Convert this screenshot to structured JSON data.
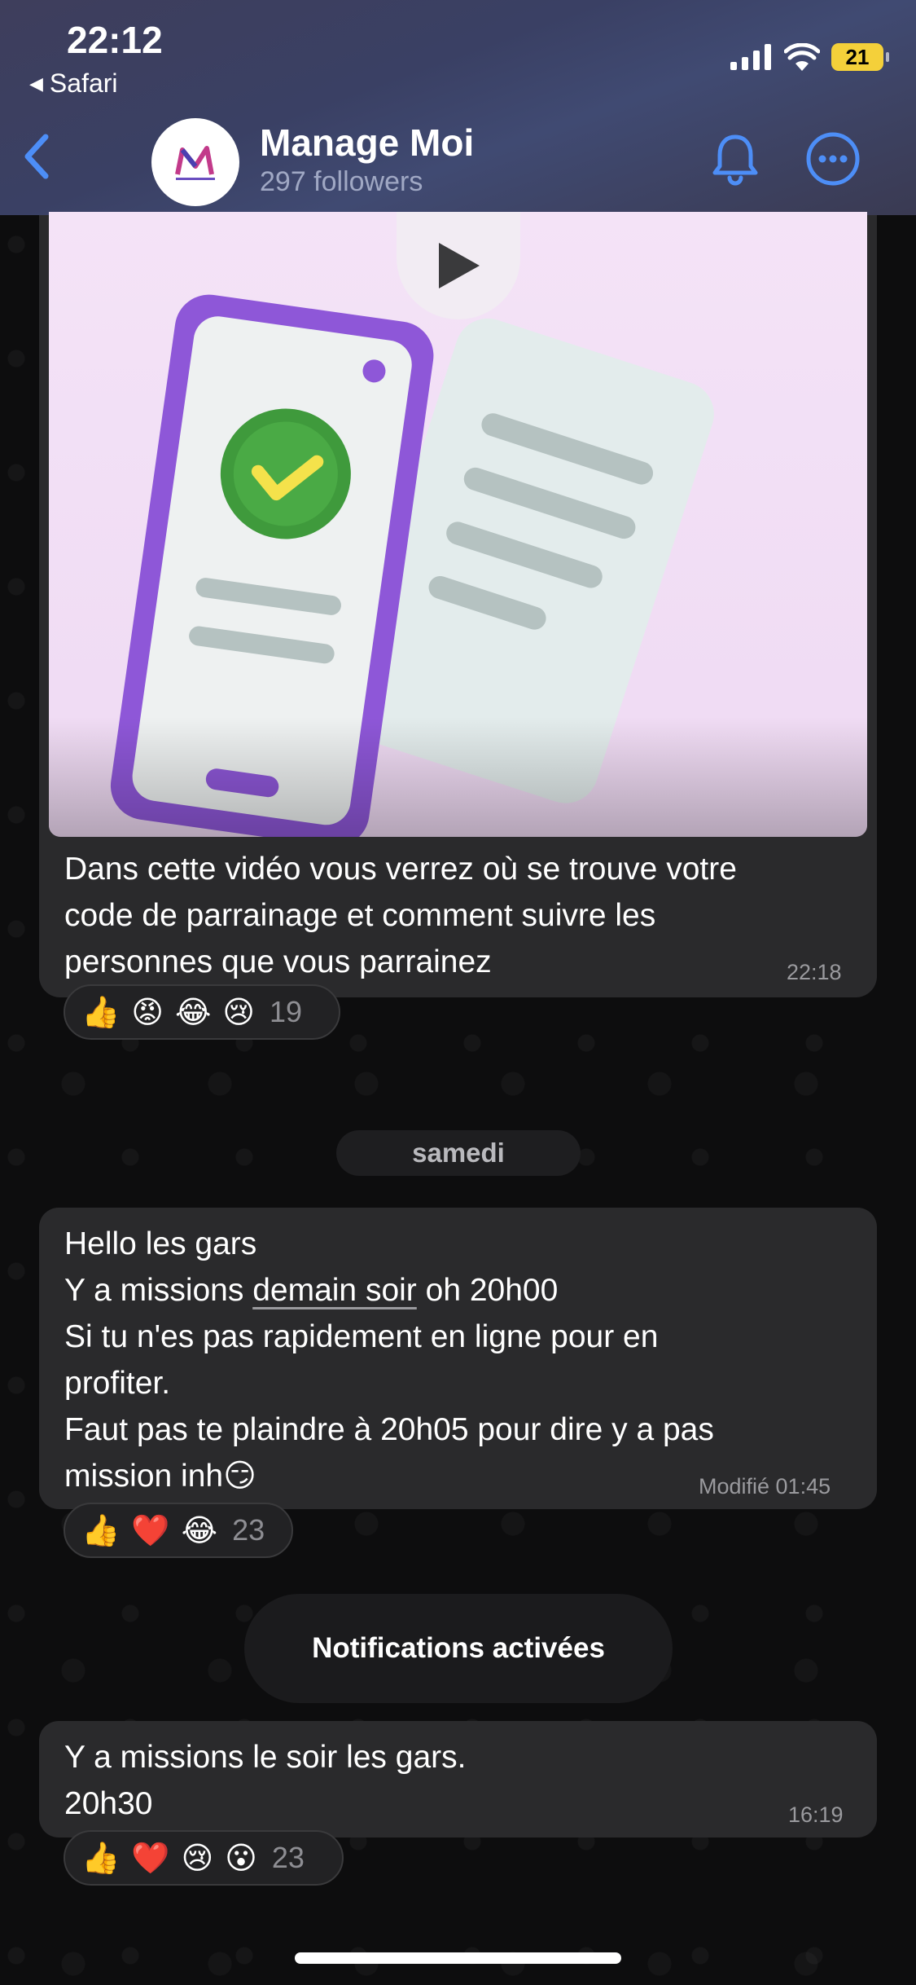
{
  "status_bar": {
    "time": "22:12",
    "back_app": "Safari",
    "battery": "21",
    "battery_color": "#f4d03a"
  },
  "header": {
    "channel_name": "Manage Moi",
    "followers": "297 followers",
    "back_icon": "chevron-left-icon",
    "bell_icon": "bell-icon",
    "more_icon": "more-icon",
    "accent_color": "#4d8ef7"
  },
  "messages": [
    {
      "type": "video",
      "caption": "Dans cette vidéo vous verrez où se trouve votre\ncode de parrainage et comment suivre les\npersonnes que vous parrainez",
      "time": "22:18",
      "reactions": [
        "👍",
        "😡",
        "😂",
        "😢"
      ],
      "reaction_count": "19"
    },
    {
      "type": "text",
      "line1": "Hello les gars",
      "line2_before": "Y a missions ",
      "line2_link": "demain soir",
      "line2_after": " oh 20h00",
      "line3": "Si tu n'es pas rapidement en ligne pour en\nprofiter.\nFaut pas te plaindre à 20h05 pour dire y a pas\nmission inh😏",
      "time": "Modifié 01:45",
      "reactions": [
        "👍",
        "❤️",
        "😂"
      ],
      "reaction_count": "23"
    },
    {
      "type": "text",
      "text": "Y a missions le soir les gars.\n20h30",
      "time": "16:19",
      "reactions": [
        "👍",
        "❤️",
        "😢",
        "😮"
      ],
      "reaction_count": "23"
    }
  ],
  "date_separator": "samedi",
  "toast": "Notifications activées"
}
